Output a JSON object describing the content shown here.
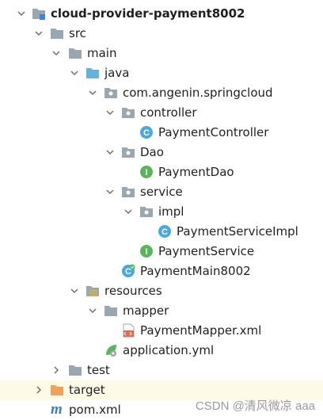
{
  "tree": {
    "items": [
      {
        "label": "cloud-provider-payment8002",
        "icon": "module-folder-icon",
        "arrow": "down"
      },
      {
        "label": "src",
        "icon": "folder-icon",
        "arrow": "down"
      },
      {
        "label": "main",
        "icon": "folder-icon",
        "arrow": "down"
      },
      {
        "label": "java",
        "icon": "source-folder-icon",
        "arrow": "down"
      },
      {
        "label": "com.angenin.springcloud",
        "icon": "package-icon",
        "arrow": "down"
      },
      {
        "label": "controller",
        "icon": "package-icon",
        "arrow": "down"
      },
      {
        "label": "PaymentController",
        "icon": "class-icon",
        "badge": "C"
      },
      {
        "label": "Dao",
        "icon": "package-icon",
        "arrow": "down"
      },
      {
        "label": "PaymentDao",
        "icon": "interface-icon",
        "badge": "I"
      },
      {
        "label": "service",
        "icon": "package-icon",
        "arrow": "down"
      },
      {
        "label": "impl",
        "icon": "package-icon",
        "arrow": "down"
      },
      {
        "label": "PaymentServiceImpl",
        "icon": "class-icon",
        "badge": "C"
      },
      {
        "label": "PaymentService",
        "icon": "interface-icon",
        "badge": "I"
      },
      {
        "label": "PaymentMain8002",
        "icon": "spring-boot-class-icon",
        "badge": "C"
      },
      {
        "label": "resources",
        "icon": "resources-folder-icon",
        "arrow": "down"
      },
      {
        "label": "mapper",
        "icon": "folder-icon",
        "arrow": "down"
      },
      {
        "label": "PaymentMapper.xml",
        "icon": "xml-file-icon"
      },
      {
        "label": "application.yml",
        "icon": "spring-config-icon"
      },
      {
        "label": "test",
        "icon": "folder-icon",
        "arrow": "right"
      },
      {
        "label": "target",
        "icon": "excluded-folder-icon",
        "arrow": "right"
      },
      {
        "label": "pom.xml",
        "icon": "maven-icon",
        "badge": "m"
      }
    ]
  },
  "colors": {
    "folder": "#9aa7b0",
    "source_folder": "#62b2dd",
    "excluded_folder": "#f0a15b",
    "class_badge": "#4aa8e0",
    "interface_badge": "#5ab55a",
    "selected_row": "#fdfbe6"
  },
  "watermark": "CSDN @清风微凉 aaa"
}
